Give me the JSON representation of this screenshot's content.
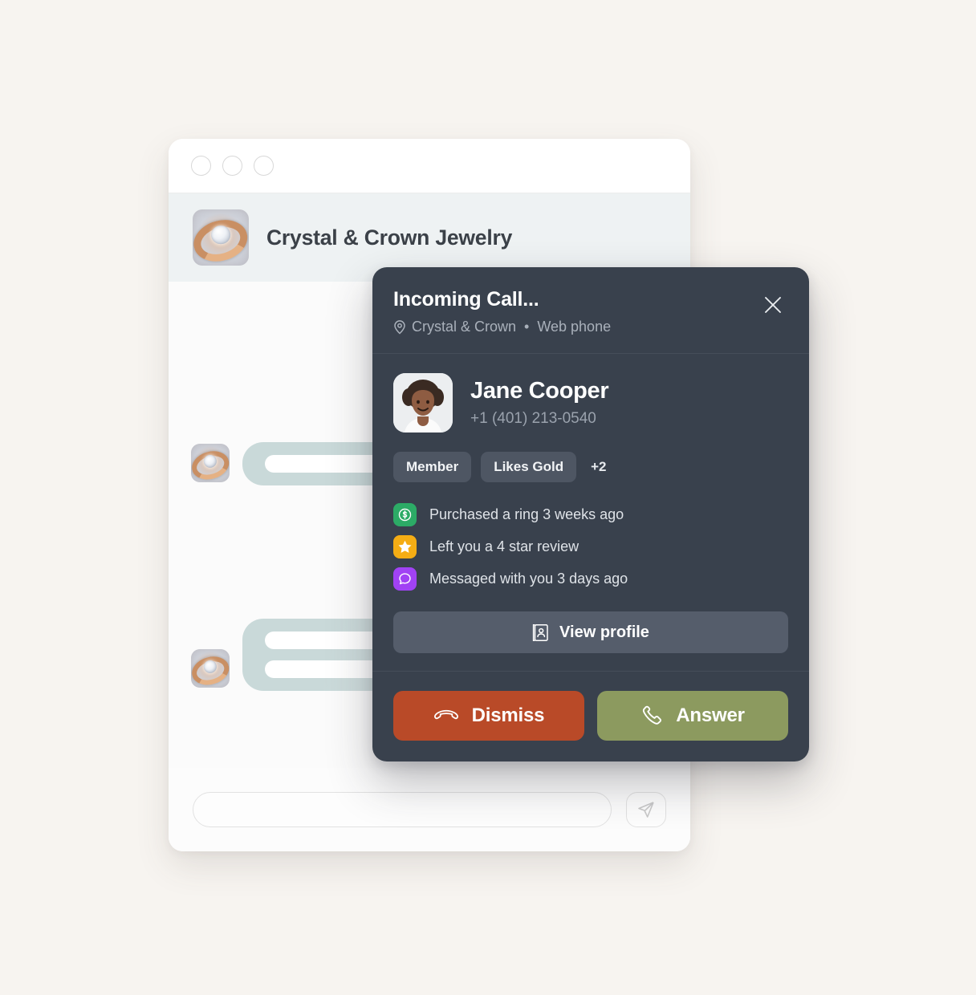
{
  "page": {
    "background_color": "#f7f4f0"
  },
  "chat_window": {
    "traffic_lights": [
      "window-dot-1",
      "window-dot-2",
      "window-dot-3"
    ],
    "shop": {
      "name": "Crystal & Crown Jewelry",
      "avatar_icon": "ring-photo-avatar"
    },
    "messages": [
      {
        "side": "out",
        "lines": 3,
        "widths": [
          150,
          150,
          150
        ],
        "avatar": false
      },
      {
        "side": "in",
        "lines": 1,
        "widths": [
          230
        ],
        "avatar": true
      },
      {
        "side": "out",
        "lines": 2,
        "widths": [
          150,
          150
        ],
        "avatar": false
      },
      {
        "side": "in",
        "lines": 2,
        "widths": [
          215,
          215
        ],
        "avatar": true
      }
    ],
    "composer": {
      "placeholder": "",
      "value": "",
      "send_icon": "send-paper-plane-icon"
    }
  },
  "call_panel": {
    "title": "Incoming Call...",
    "location_icon": "location-pin-icon",
    "location": "Crystal & Crown",
    "separator": "•",
    "channel": "Web phone",
    "close_icon": "close-icon",
    "contact": {
      "avatar_icon": "contact-photo-avatar",
      "name": "Jane Cooper",
      "phone": "+1 (401) 213-0540"
    },
    "tags": [
      "Member",
      "Likes Gold"
    ],
    "tags_overflow": "+2",
    "activity": [
      {
        "icon": "dollar-coin-icon",
        "icon_color": "#2cab66",
        "text": "Purchased a ring 3 weeks ago"
      },
      {
        "icon": "star-icon",
        "icon_color": "#f5ad14",
        "text": "Left you a 4 star review"
      },
      {
        "icon": "chat-bubble-icon",
        "icon_color": "#a142f4",
        "text": "Messaged with you 3 days ago"
      }
    ],
    "view_profile": {
      "label": "View profile",
      "icon": "contact-card-icon"
    },
    "dismiss": {
      "label": "Dismiss",
      "icon": "phone-hangup-icon",
      "color": "#b94a28"
    },
    "answer": {
      "label": "Answer",
      "icon": "phone-handset-icon",
      "color": "#8c9a5f"
    }
  },
  "colors": {
    "panel_bg": "#39414d",
    "chip_bg": "#4e5663",
    "profile_btn_bg": "#555d6b",
    "bubble": "#c9d9d9",
    "chat_header": "#eef2f3"
  }
}
